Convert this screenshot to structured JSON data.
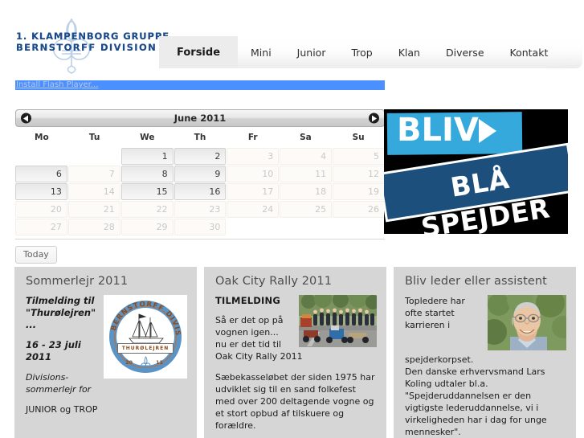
{
  "site": {
    "logo_line1": "1.  KLAMPENBORG  GRUPPE",
    "logo_line2": "BERNSTORFF  DIVISION",
    "logo_icon": "scout-fleur-de-lis"
  },
  "nav": {
    "items": [
      {
        "label": "Forside",
        "active": true
      },
      {
        "label": "Mini",
        "active": false
      },
      {
        "label": "Junior",
        "active": false
      },
      {
        "label": "Trop",
        "active": false
      },
      {
        "label": "Klan",
        "active": false
      },
      {
        "label": "Diverse",
        "active": false
      },
      {
        "label": "Kontakt",
        "active": false
      }
    ]
  },
  "flash_notice": {
    "link_text": "Install Flash Player...",
    "bar_color": "#4a90ff",
    "link_color": "#b9c9ee"
  },
  "calendar": {
    "title": "June 2011",
    "prev_label": "◀",
    "next_label": "▶",
    "day_names": [
      "Mo",
      "Tu",
      "We",
      "Th",
      "Fr",
      "Sa",
      "Su"
    ],
    "today_label": "Today",
    "weeks": [
      [
        {
          "day": "",
          "event": false,
          "empty": true
        },
        {
          "day": "",
          "event": false,
          "empty": true
        },
        {
          "day": "1",
          "event": true
        },
        {
          "day": "2",
          "event": true
        },
        {
          "day": "3",
          "event": false
        },
        {
          "day": "4",
          "event": false
        },
        {
          "day": "5",
          "event": false
        }
      ],
      [
        {
          "day": "6",
          "event": true
        },
        {
          "day": "7",
          "event": false
        },
        {
          "day": "8",
          "event": true
        },
        {
          "day": "9",
          "event": true
        },
        {
          "day": "10",
          "event": false
        },
        {
          "day": "11",
          "event": false
        },
        {
          "day": "12",
          "event": false
        }
      ],
      [
        {
          "day": "13",
          "event": true
        },
        {
          "day": "14",
          "event": false
        },
        {
          "day": "15",
          "event": true
        },
        {
          "day": "16",
          "event": true
        },
        {
          "day": "17",
          "event": false
        },
        {
          "day": "18",
          "event": false
        },
        {
          "day": "19",
          "event": false
        }
      ],
      [
        {
          "day": "20",
          "event": false
        },
        {
          "day": "21",
          "event": false
        },
        {
          "day": "22",
          "event": false
        },
        {
          "day": "23",
          "event": false
        },
        {
          "day": "24",
          "event": false
        },
        {
          "day": "25",
          "event": false
        },
        {
          "day": "26",
          "event": false
        }
      ],
      [
        {
          "day": "27",
          "event": false
        },
        {
          "day": "28",
          "event": false
        },
        {
          "day": "29",
          "event": false
        },
        {
          "day": "30",
          "event": false
        },
        {
          "day": "",
          "event": false,
          "empty": true
        },
        {
          "day": "",
          "event": false,
          "empty": true
        },
        {
          "day": "",
          "event": false,
          "empty": true
        }
      ]
    ]
  },
  "banner": {
    "line1": "BLIV",
    "line2": "BLÅ SPEJDER",
    "arrow_icon": "chevron-right-icon",
    "color_light": "#35a8dc",
    "color_dark": "#1d4f7c",
    "background": "#000000"
  },
  "cards": [
    {
      "id": "sommerlejr",
      "title": "Sommerlejr 2011",
      "image_name": "thurolejren-badge-image",
      "paragraphs": [
        {
          "text": "Tilmelding til \"Thurølejren\" ...",
          "style": "bold-italic"
        },
        {
          "text": "16 - 23 juli 2011",
          "style": "bold-italic"
        },
        {
          "text": " Divisions-sommerlejr for",
          "style": "italic"
        },
        {
          "text": "JUNIOR og TROP",
          "style": "normal"
        }
      ]
    },
    {
      "id": "oak-city-rally",
      "title": "Oak City Rally 2011",
      "image_name": "soapbox-rally-photo",
      "paragraphs": [
        {
          "text": "TILMELDING",
          "style": "caps-bold"
        },
        {
          "text": "Så er det op på vognen igen... nu er det tid til Oak City Rally 2011",
          "style": "normal"
        },
        {
          "text": "Sæbekasseløbet der siden 1975 har udviklet sig til en sand folkefest med over 200 deltagende vogne og et stort opbud af tilskuere og forældre.",
          "style": "normal"
        }
      ]
    },
    {
      "id": "bliv-leder",
      "title": "Bliv leder eller assistent",
      "image_name": "lars-koling-portrait-photo",
      "paragraphs": [
        {
          "text": "Topledere har ofte startet karrieren i",
          "style": "normal"
        },
        {
          "text": "spejderkorpset.\nDen danske erhvervsmand Lars Koling udtaler bl.a. \"Spejderuddannelsen er den vigtigste lederuddannelse, vi i virkeligheden har i dag for unge mennesker\".",
          "style": "normal"
        }
      ]
    }
  ]
}
